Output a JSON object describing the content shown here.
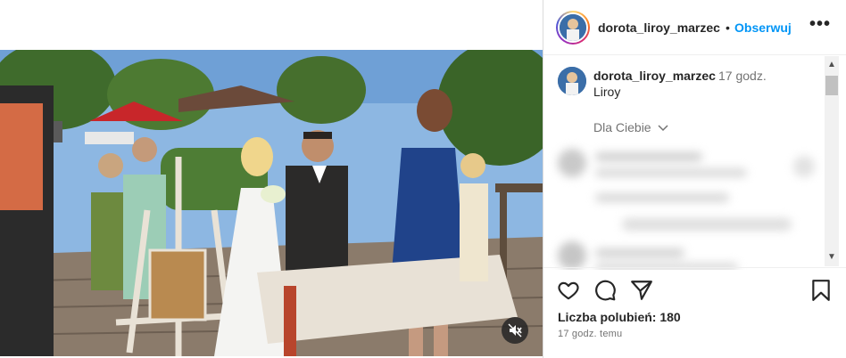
{
  "post": {
    "username": "dorota_liroy_marzec",
    "follow_label": "Obserwuj",
    "separator": "•",
    "more_label": "•••",
    "caption_user": "dorota_liroy_marzec",
    "caption_time": "17 godz.",
    "caption_text": "Liroy",
    "comment_filter": "Dla Ciebie",
    "likes_text": "Liczba polubień: 180",
    "posted_ago": "17 godz. temu"
  },
  "icons": {
    "like": "heart-icon",
    "comment": "comment-icon",
    "share": "paper-plane-icon",
    "save": "bookmark-icon",
    "mute": "speaker-muted-icon",
    "more": "ellipsis-icon"
  },
  "colors": {
    "follow_blue": "#0095f6",
    "text": "#262626",
    "muted": "#737373"
  }
}
